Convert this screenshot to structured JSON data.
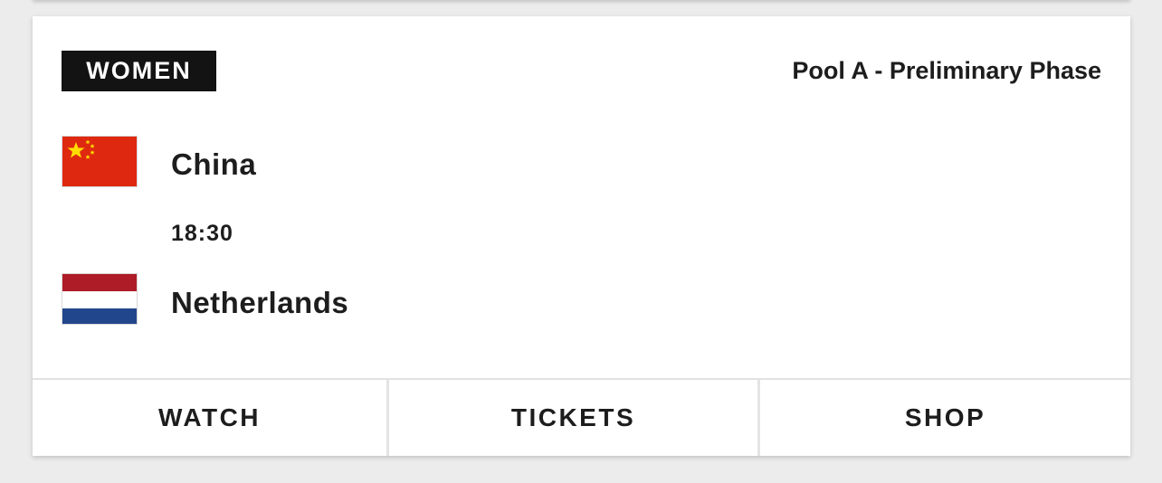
{
  "match": {
    "category": "WOMEN",
    "phase": "Pool A - Preliminary Phase",
    "time": "18:30",
    "team_home": {
      "name": "China",
      "flag_icon": "china-flag-icon"
    },
    "team_away": {
      "name": "Netherlands",
      "flag_icon": "netherlands-flag-icon"
    }
  },
  "actions": {
    "watch": "WATCH",
    "tickets": "TICKETS",
    "shop": "SHOP"
  },
  "colors": {
    "badge_background": "#131313",
    "page_background": "#ececec",
    "card_background": "#ffffff",
    "text": "#1d1d1d",
    "china_red": "#de2910",
    "china_star": "#ffde00",
    "netherlands_red": "#ae1c28",
    "netherlands_blue": "#21468b"
  }
}
